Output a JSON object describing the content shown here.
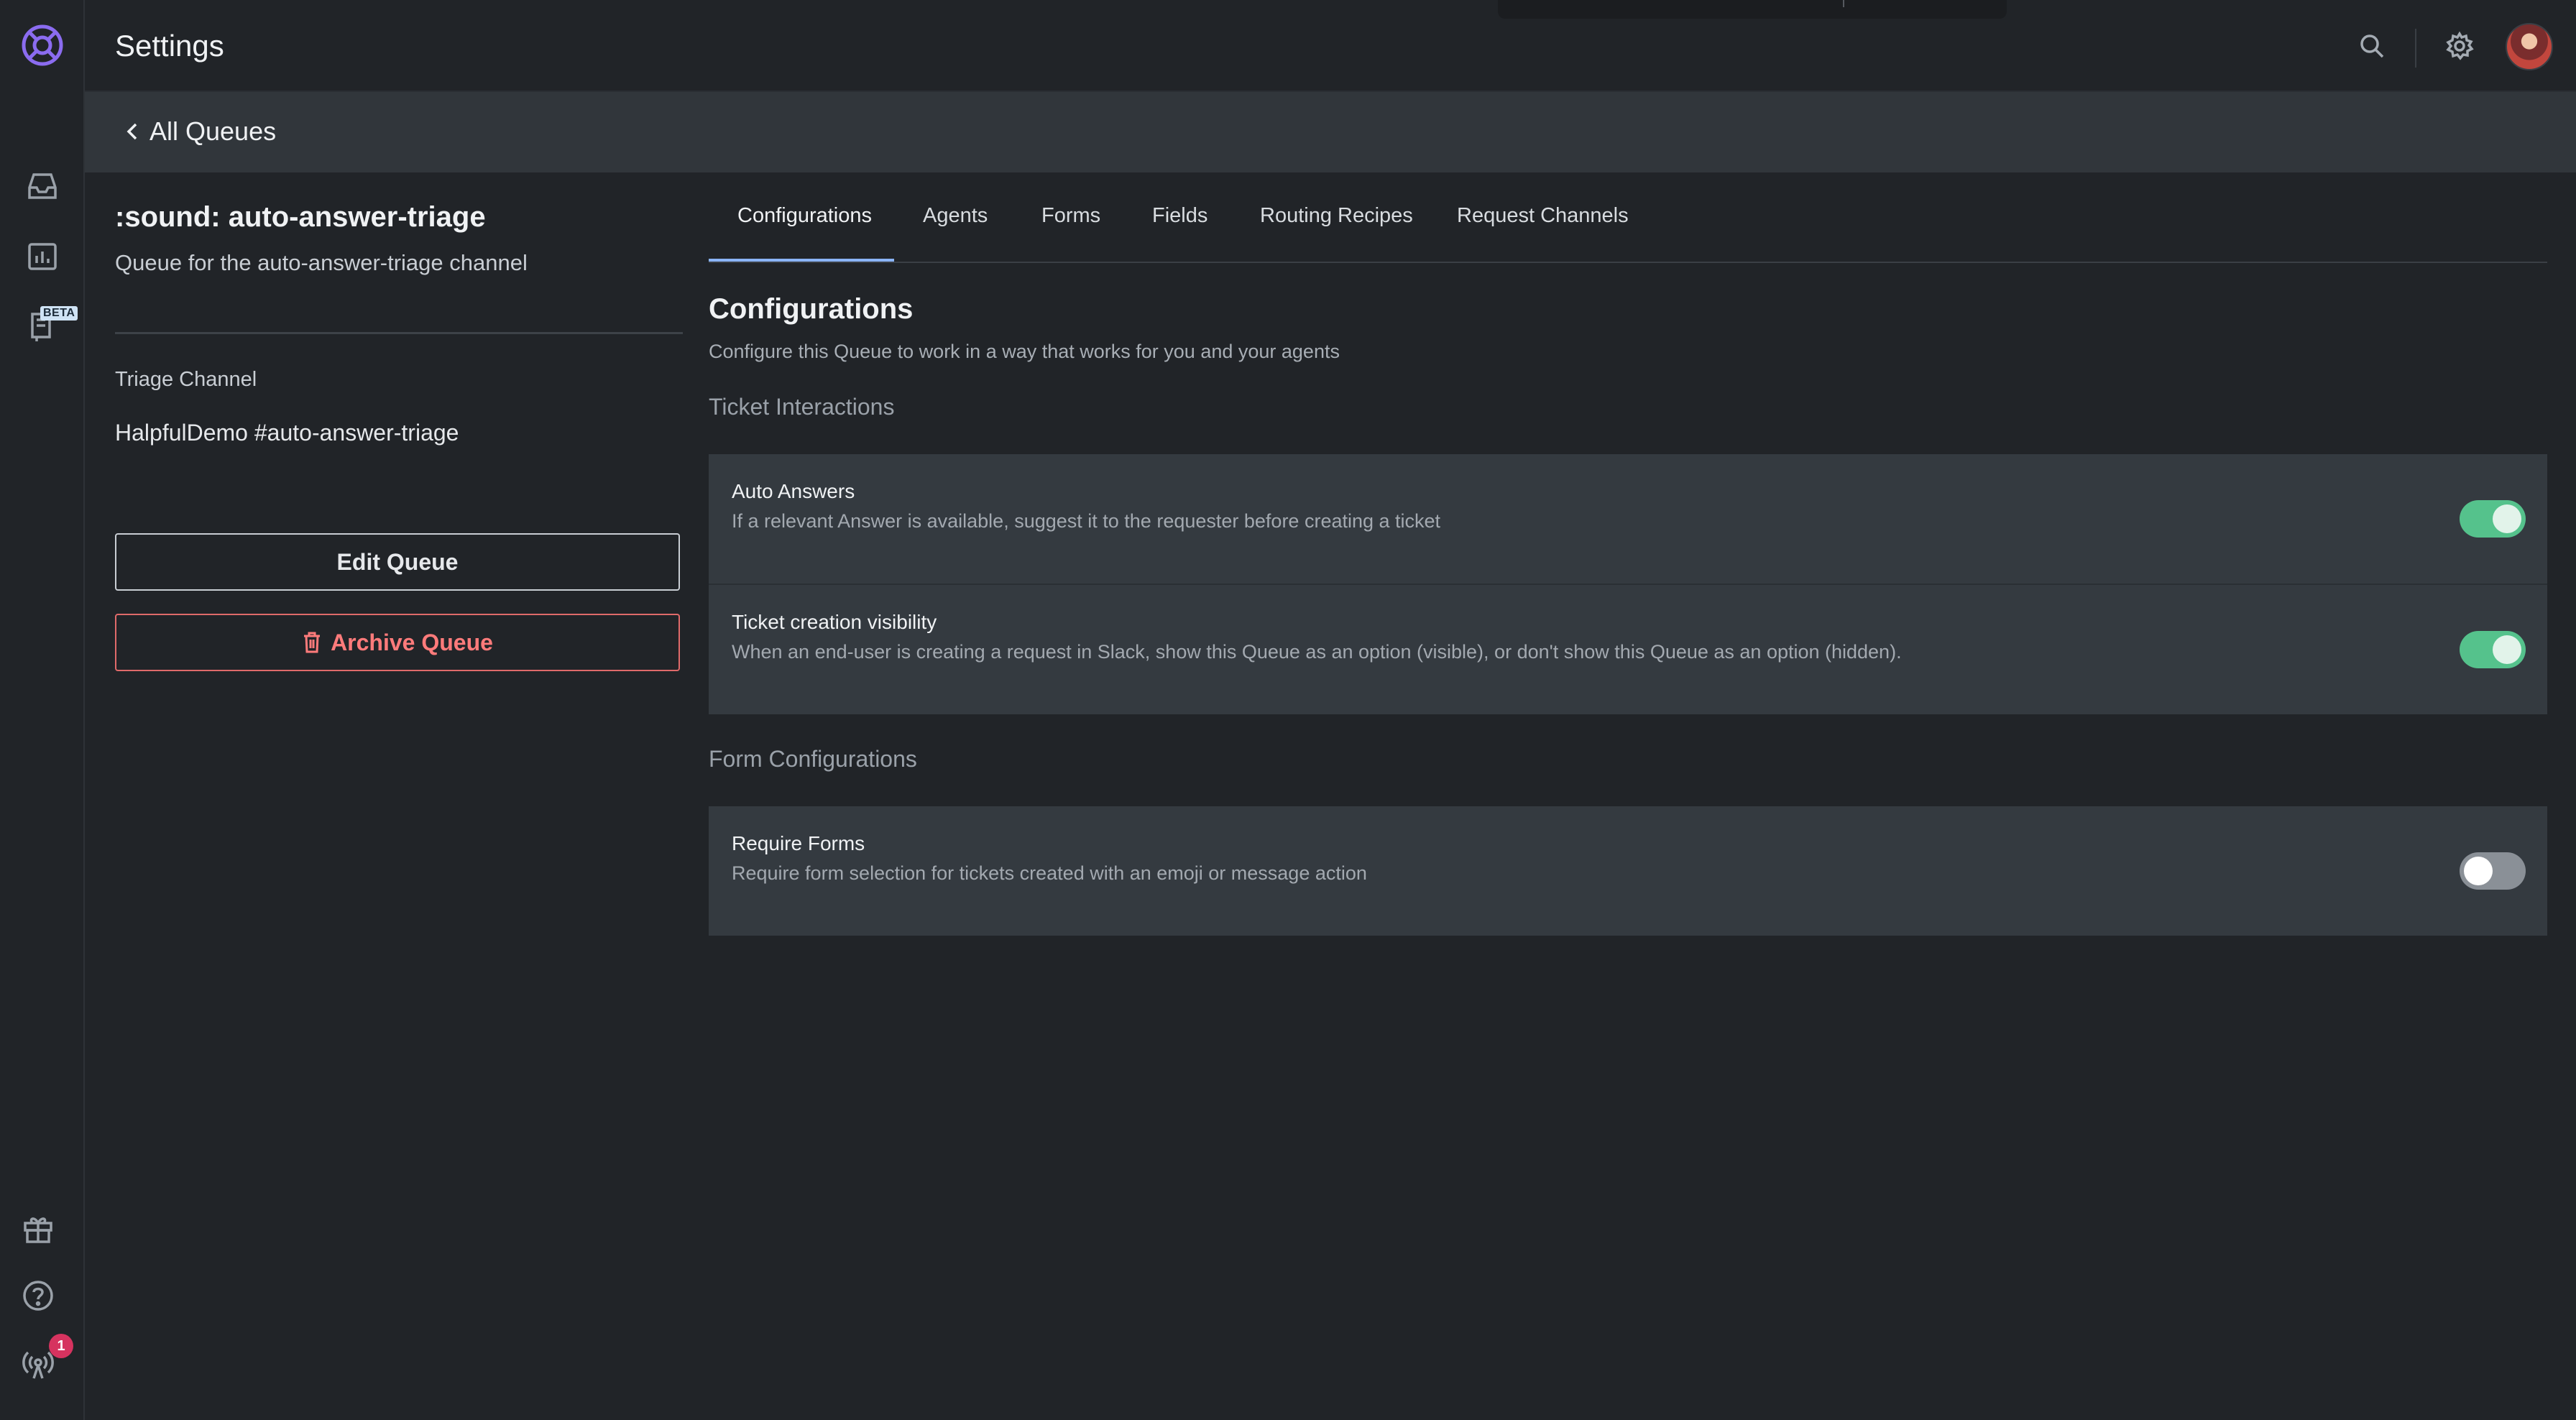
{
  "app": {
    "page_title": "Settings"
  },
  "rail": {
    "icons": [
      "app-logo-icon",
      "inbox-icon",
      "analytics-icon",
      "knowledge-icon",
      "gift-icon",
      "help-icon",
      "broadcast-icon"
    ],
    "beta_label": "BETA",
    "notification_count": "1"
  },
  "header": {
    "icons": [
      "search-icon",
      "gear-icon",
      "user-avatar"
    ]
  },
  "breadcrumb": {
    "label": "All Queues"
  },
  "queue": {
    "title": ":sound: auto-answer-triage",
    "description": "Queue for the auto-answer-triage channel",
    "triage_channel_label": "Triage Channel",
    "triage_channel_value": "HalpfulDemo #auto-answer-triage",
    "edit_label": "Edit Queue",
    "archive_label": "Archive Queue"
  },
  "tabs": [
    {
      "label": "Configurations",
      "active": true
    },
    {
      "label": "Agents",
      "active": false
    },
    {
      "label": "Forms",
      "active": false
    },
    {
      "label": "Fields",
      "active": false
    },
    {
      "label": "Routing Recipes",
      "active": false
    },
    {
      "label": "Request Channels",
      "active": false
    }
  ],
  "content": {
    "title": "Configurations",
    "subtitle": "Configure this Queue to work in a way that works for you and your agents",
    "groups": [
      {
        "heading": "Ticket Interactions",
        "settings": [
          {
            "title": "Auto Answers",
            "description": "If a relevant Answer is available, suggest it to the requester before creating a ticket",
            "enabled": true
          },
          {
            "title": "Ticket creation visibility",
            "description": "When an end-user is creating a request in Slack, show this Queue as an option (visible), or don't show this Queue as an option (hidden).",
            "enabled": true
          }
        ]
      },
      {
        "heading": "Form Configurations",
        "settings": [
          {
            "title": "Require Forms",
            "description": "Require form selection for tickets created with an emoji or message action",
            "enabled": false
          }
        ]
      }
    ]
  },
  "colors": {
    "accent_tab": "#8ab4f8",
    "toggle_on": "#55c28c",
    "danger": "#ff7b7b",
    "logo": "#8b6cf0"
  }
}
